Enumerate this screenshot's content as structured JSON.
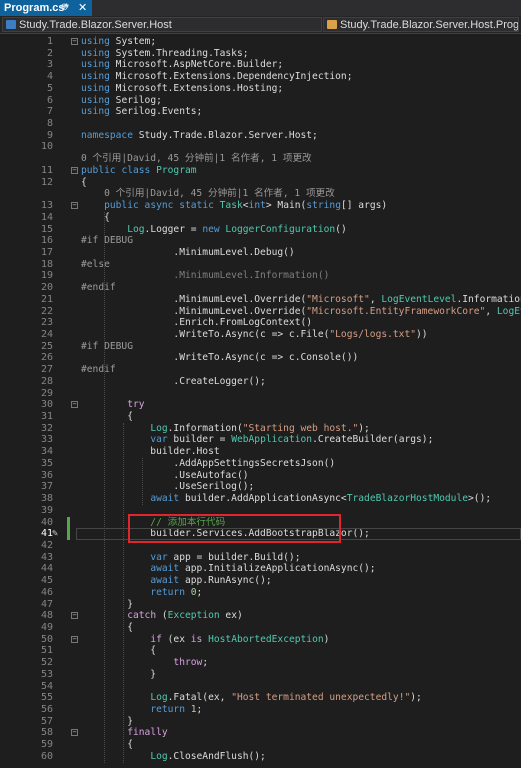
{
  "tab": {
    "label": "Program.cs*",
    "pin": "⊕",
    "close": "✕"
  },
  "nav": {
    "left": "Study.Trade.Blazor.Server.Host",
    "right": "Study.Trade.Blazor.Server.Host.Program"
  },
  "codelens": {
    "class": "0 个引用|David, 45 分钟前|1 名作者, 1 项更改",
    "method": "0 个引用|David, 45 分钟前|1 名作者, 1 项更改"
  },
  "lines": [
    {
      "n": "1",
      "t": "using System;"
    },
    {
      "n": "2",
      "t": "using System.Threading.Tasks;"
    },
    {
      "n": "3",
      "t": "using Microsoft.AspNetCore.Builder;"
    },
    {
      "n": "4",
      "t": "using Microsoft.Extensions.DependencyInjection;"
    },
    {
      "n": "5",
      "t": "using Microsoft.Extensions.Hosting;"
    },
    {
      "n": "6",
      "t": "using Serilog;"
    },
    {
      "n": "7",
      "t": "using Serilog.Events;"
    },
    {
      "n": "8",
      "t": ""
    },
    {
      "n": "9",
      "t": "namespace Study.Trade.Blazor.Server.Host;"
    },
    {
      "n": "10",
      "t": ""
    },
    {
      "n": "11",
      "t": "public class Program"
    },
    {
      "n": "12",
      "t": "{"
    },
    {
      "n": "13",
      "t": "    public async static Task<int> Main(string[] args)"
    },
    {
      "n": "14",
      "t": "    {"
    },
    {
      "n": "15",
      "t": "        Log.Logger = new LoggerConfiguration()"
    },
    {
      "n": "16",
      "t": "#if DEBUG"
    },
    {
      "n": "17",
      "t": "                .MinimumLevel.Debug()"
    },
    {
      "n": "18",
      "t": "#else"
    },
    {
      "n": "19",
      "t": "                .MinimumLevel.Information()"
    },
    {
      "n": "20",
      "t": "#endif"
    },
    {
      "n": "21",
      "t": "                .MinimumLevel.Override(\"Microsoft\", LogEventLevel.Information)"
    },
    {
      "n": "22",
      "t": "                .MinimumLevel.Override(\"Microsoft.EntityFrameworkCore\", LogEventLevel.Warning)"
    },
    {
      "n": "23",
      "t": "                .Enrich.FromLogContext()"
    },
    {
      "n": "24",
      "t": "                .WriteTo.Async(c => c.File(\"Logs/logs.txt\"))"
    },
    {
      "n": "25",
      "t": "#if DEBUG"
    },
    {
      "n": "26",
      "t": "                .WriteTo.Async(c => c.Console())"
    },
    {
      "n": "27",
      "t": "#endif"
    },
    {
      "n": "28",
      "t": "                .CreateLogger();"
    },
    {
      "n": "29",
      "t": ""
    },
    {
      "n": "30",
      "t": "        try"
    },
    {
      "n": "31",
      "t": "        {"
    },
    {
      "n": "32",
      "t": "            Log.Information(\"Starting web host.\");"
    },
    {
      "n": "33",
      "t": "            var builder = WebApplication.CreateBuilder(args);"
    },
    {
      "n": "34",
      "t": "            builder.Host"
    },
    {
      "n": "35",
      "t": "                .AddAppSettingsSecretsJson()"
    },
    {
      "n": "36",
      "t": "                .UseAutofac()"
    },
    {
      "n": "37",
      "t": "                .UseSerilog();"
    },
    {
      "n": "38",
      "t": "            await builder.AddApplicationAsync<TradeBlazorHostModule>();"
    },
    {
      "n": "39",
      "t": ""
    },
    {
      "n": "40",
      "t": "            // 添加本行代码"
    },
    {
      "n": "41",
      "t": "            builder.Services.AddBootstrapBlazor();"
    },
    {
      "n": "42",
      "t": ""
    },
    {
      "n": "43",
      "t": "            var app = builder.Build();"
    },
    {
      "n": "44",
      "t": "            await app.InitializeApplicationAsync();"
    },
    {
      "n": "45",
      "t": "            await app.RunAsync();"
    },
    {
      "n": "46",
      "t": "            return 0;"
    },
    {
      "n": "47",
      "t": "        }"
    },
    {
      "n": "48",
      "t": "        catch (Exception ex)"
    },
    {
      "n": "49",
      "t": "        {"
    },
    {
      "n": "50",
      "t": "            if (ex is HostAbortedException)"
    },
    {
      "n": "51",
      "t": "            {"
    },
    {
      "n": "52",
      "t": "                throw;"
    },
    {
      "n": "53",
      "t": "            }"
    },
    {
      "n": "54",
      "t": ""
    },
    {
      "n": "55",
      "t": "            Log.Fatal(ex, \"Host terminated unexpectedly!\");"
    },
    {
      "n": "56",
      "t": "            return 1;"
    },
    {
      "n": "57",
      "t": "        }"
    },
    {
      "n": "58",
      "t": "        finally"
    },
    {
      "n": "59",
      "t": "        {"
    },
    {
      "n": "60",
      "t": "            Log.CloseAndFlush();"
    }
  ],
  "colors": {
    "accent_tab": "#0e639c",
    "highlight_box": "#e0262c",
    "keyword": "#569cd6",
    "type": "#4ec9b0",
    "string": "#d69d85",
    "comment": "#57a64a"
  }
}
